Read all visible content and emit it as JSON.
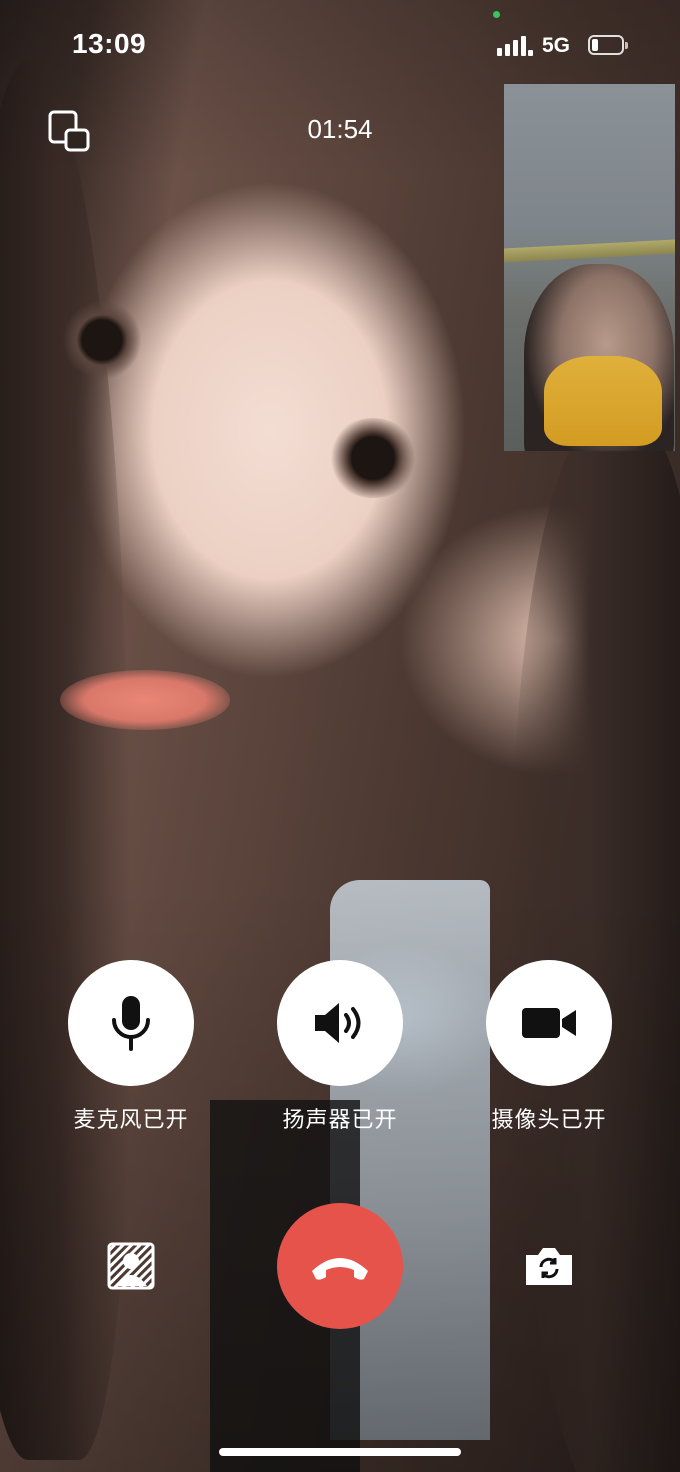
{
  "status_bar": {
    "time": "13:09",
    "network": "5G",
    "battery_level": 0.22
  },
  "call": {
    "timer": "01:54"
  },
  "controls": {
    "microphone": {
      "label": "麦克风已开",
      "icon": "microphone-icon"
    },
    "speaker": {
      "label": "扬声器已开",
      "icon": "speaker-icon"
    },
    "camera": {
      "label": "摄像头已开",
      "icon": "video-camera-icon"
    }
  },
  "bottom_bar": {
    "left_icon": "blur-background-icon",
    "center_icon": "hang-up-icon",
    "right_icon": "switch-camera-icon"
  },
  "colors": {
    "hangup": "#e5534b",
    "button_bg": "#ffffff",
    "label_text": "#ffffff",
    "status_dot": "#35c759"
  }
}
